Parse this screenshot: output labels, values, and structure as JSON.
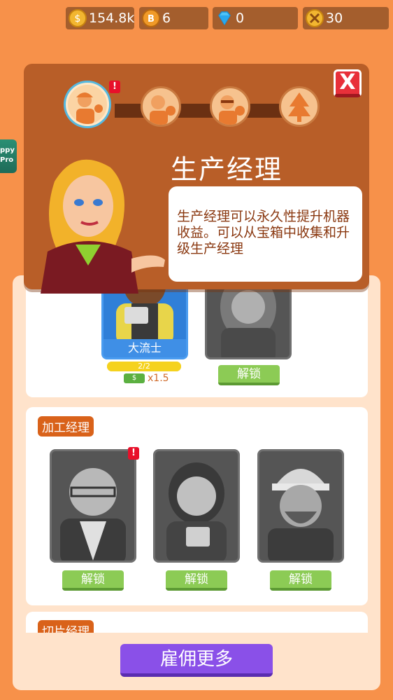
{
  "resources": {
    "coins": "154.8k",
    "tokens": "6",
    "gems": "0",
    "badges": "30"
  },
  "side_promo": {
    "line1": "ppy",
    "line2": "Pro"
  },
  "dialog": {
    "title": "生产经理",
    "description": "生产经理可以永久性提升机器收益。可以从宝箱中收集和升级生产经理",
    "close_label": "X",
    "alert_mark": "!"
  },
  "top_section": {
    "card1": {
      "name": "大流士",
      "progress": "2/2",
      "progress_fraction": 1.0,
      "multiplier": "x1.5"
    },
    "unlock_label": "解锁"
  },
  "processing_section": {
    "title": "加工经理",
    "alert_mark": "!",
    "unlock_labels": [
      "解锁",
      "解锁",
      "解锁"
    ]
  },
  "slicing_section": {
    "title": "切片经理"
  },
  "hire_button": "雇佣更多",
  "colors": {
    "background": "#f7914a",
    "dialog": "#b85e28",
    "unlock_green": "#8ccb55",
    "hire_purple": "#8a50e8",
    "tag_orange": "#d9621a"
  }
}
